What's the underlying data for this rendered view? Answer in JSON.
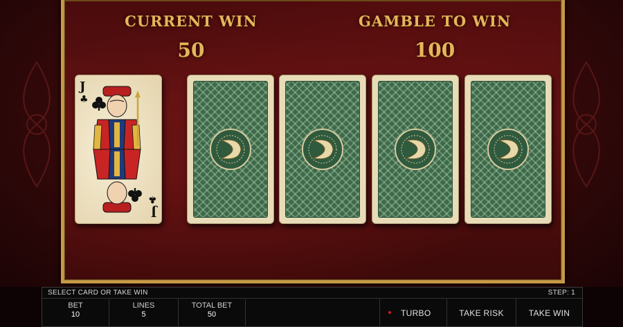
{
  "game": {
    "current_win_label": "CURRENT WIN",
    "current_win_value": "50",
    "gamble_to_win_label": "GAMBLE TO WIN",
    "gamble_to_win_value": "100"
  },
  "dealer_card": {
    "rank": "J",
    "suit": "♣",
    "suit_name": "clubs"
  },
  "card_backs": [
    {
      "icon": "card-back-emblem"
    },
    {
      "icon": "card-back-emblem"
    },
    {
      "icon": "card-back-emblem"
    },
    {
      "icon": "card-back-emblem"
    }
  ],
  "status_bar": {
    "message": "SELECT CARD OR TAKE WIN",
    "step": "STEP: 1"
  },
  "stats": {
    "bet_label": "BET",
    "bet_value": "10",
    "lines_label": "LINES",
    "lines_value": "5",
    "total_bet_label": "TOTAL BET",
    "total_bet_value": "50"
  },
  "buttons": {
    "turbo": "TURBO",
    "take_risk": "TAKE RISK",
    "take_win": "TAKE WIN"
  },
  "colors": {
    "gold_text": "#e7b45a",
    "frame_gold": "#c69a47",
    "card_back_green": "#3c6a4a",
    "turbo_indicator": "#d21a1a"
  }
}
